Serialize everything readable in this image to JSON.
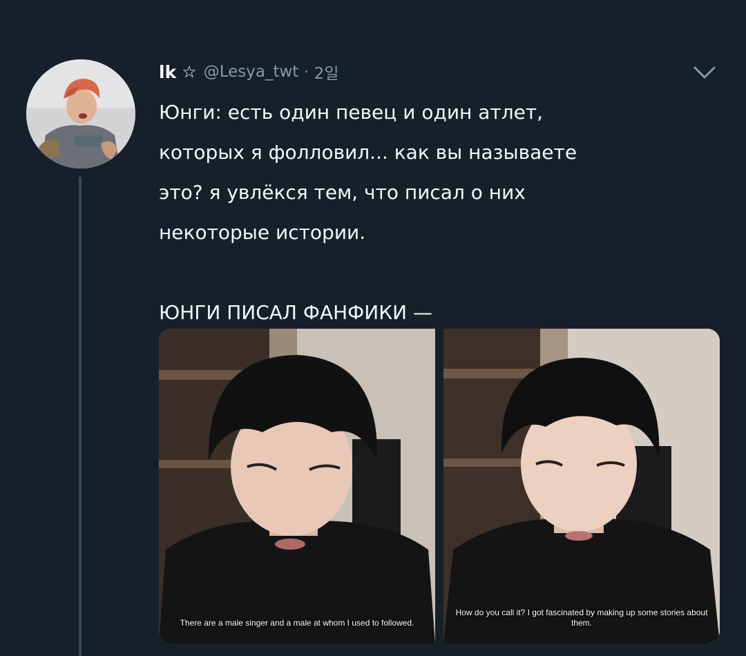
{
  "tweet": {
    "display_name": "lk",
    "badge": "☆",
    "handle": "@Lesya_twt",
    "separator": "·",
    "time": "2일",
    "text_lines": [
      "Юнги: есть один певец и один атлет,",
      "которых я фолловил... как вы называете",
      "это? я увлёкся тем, что писал о них",
      "некоторые истории."
    ],
    "text_last": "ЮНГИ ПИСАЛ ФАНФИКИ —",
    "media": {
      "left_caption": "There are a male singer and a male at whom I used to followed.",
      "right_caption": "How do you call it? I got fascinated by making up some stories about them."
    }
  },
  "icons": {
    "caret": "chevron-down-icon",
    "avatar": "avatar"
  },
  "colors": {
    "background": "#15202b",
    "text": "#f5f8fa",
    "muted": "#8899a6",
    "thread_line": "#3a4a58"
  }
}
